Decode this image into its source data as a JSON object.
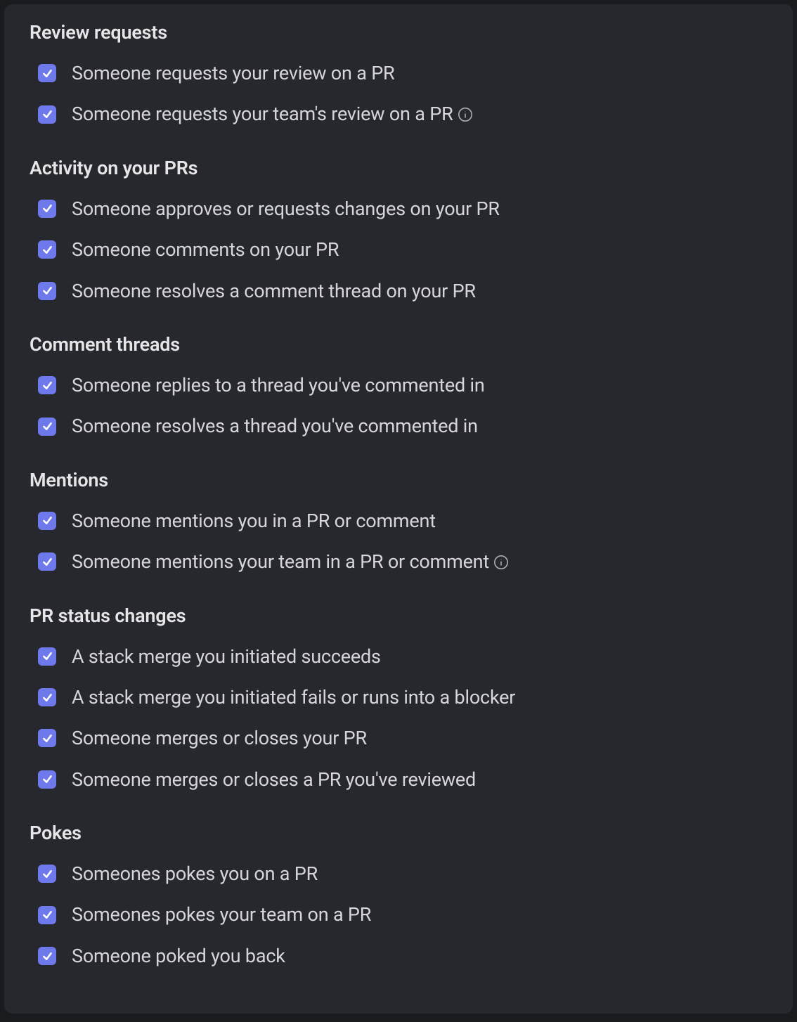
{
  "colors": {
    "checkbox": "#6e79ec",
    "panel_bg": "#27282d",
    "title_text": "#e6e6e8",
    "label_text": "#d6d6da"
  },
  "sections": [
    {
      "title": "Review requests",
      "options": [
        {
          "label": "Someone requests your review on a PR",
          "checked": true,
          "info": false
        },
        {
          "label": "Someone requests your team's review on a PR",
          "checked": true,
          "info": true
        }
      ]
    },
    {
      "title": "Activity on your PRs",
      "options": [
        {
          "label": "Someone approves or requests changes on your PR",
          "checked": true,
          "info": false
        },
        {
          "label": "Someone comments on your PR",
          "checked": true,
          "info": false
        },
        {
          "label": "Someone resolves a comment thread on your PR",
          "checked": true,
          "info": false
        }
      ]
    },
    {
      "title": "Comment threads",
      "options": [
        {
          "label": "Someone replies to a thread you've commented in",
          "checked": true,
          "info": false
        },
        {
          "label": "Someone resolves a thread you've commented in",
          "checked": true,
          "info": false
        }
      ]
    },
    {
      "title": "Mentions",
      "options": [
        {
          "label": "Someone mentions you in a PR or comment",
          "checked": true,
          "info": false
        },
        {
          "label": "Someone mentions your team in a PR or comment",
          "checked": true,
          "info": true
        }
      ]
    },
    {
      "title": "PR status changes",
      "options": [
        {
          "label": "A stack merge you initiated succeeds",
          "checked": true,
          "info": false
        },
        {
          "label": "A stack merge you initiated fails or runs into a blocker",
          "checked": true,
          "info": false
        },
        {
          "label": "Someone merges or closes your PR",
          "checked": true,
          "info": false
        },
        {
          "label": "Someone merges or closes a PR you've reviewed",
          "checked": true,
          "info": false
        }
      ]
    },
    {
      "title": "Pokes",
      "options": [
        {
          "label": "Someones pokes you on a PR",
          "checked": true,
          "info": false
        },
        {
          "label": "Someones pokes your team on a PR",
          "checked": true,
          "info": false
        },
        {
          "label": "Someone poked you back",
          "checked": true,
          "info": false
        }
      ]
    }
  ]
}
